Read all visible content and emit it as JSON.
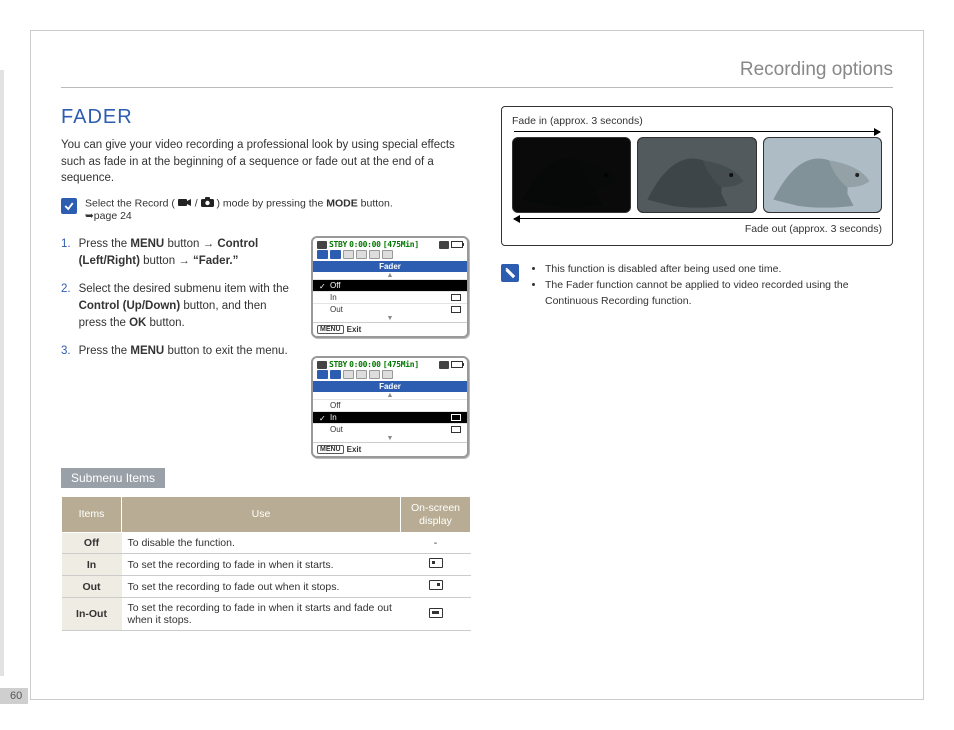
{
  "header": {
    "title": "Recording options"
  },
  "section": {
    "title": "FADER",
    "intro": "You can give your video recording a professional look by using special effects such as fade in at the beginning of a sequence or fade out at the end of a sequence."
  },
  "mode_note": {
    "prefix": "Select the Record (",
    "mid": " / ",
    "suffix": ") mode by pressing the ",
    "mode_word": "MODE",
    "suffix2": " button.",
    "pageref": "➥page 24"
  },
  "steps": [
    {
      "num": "1.",
      "html": "Press the <b>MENU</b> button → <b>Control (Left/Right)</b> button → <b>“Fader.”</b>"
    },
    {
      "num": "2.",
      "html": "Select the desired submenu item with the <b>Control (Up/Down)</b> button, and then press the <b>OK</b> button."
    },
    {
      "num": "3.",
      "html": "Press the <b>MENU</b> button to exit the menu."
    }
  ],
  "lcd": {
    "status": "STBY",
    "time": "0:00:00",
    "remain": "[475Min]",
    "menu_title": "Fader",
    "rows1": [
      {
        "label": "Off",
        "selected": true,
        "checked": true,
        "ind": false
      },
      {
        "label": "In",
        "selected": false,
        "checked": false,
        "ind": true
      },
      {
        "label": "Out",
        "selected": false,
        "checked": false,
        "ind": true
      }
    ],
    "rows2": [
      {
        "label": "Off",
        "selected": false,
        "checked": false,
        "ind": false
      },
      {
        "label": "In",
        "selected": true,
        "checked": true,
        "ind": true
      },
      {
        "label": "Out",
        "selected": false,
        "checked": false,
        "ind": true
      }
    ],
    "menu_btn": "MENU",
    "exit": "Exit"
  },
  "submenu": {
    "heading": "Submenu Items",
    "cols": {
      "c1": "Items",
      "c2": "Use",
      "c3": "On-screen display"
    },
    "rows": [
      {
        "item": "Off",
        "use": "To disable the function.",
        "disp": "-"
      },
      {
        "item": "In",
        "use": "To set the recording to fade in when it starts.",
        "disp": "in"
      },
      {
        "item": "Out",
        "use": "To set the recording to fade out when it stops.",
        "disp": "out"
      },
      {
        "item": "In-Out",
        "use": "To set the recording to fade in when it starts and fade out when it stops.",
        "disp": "inout"
      }
    ]
  },
  "fadebox": {
    "top": "Fade in (approx. 3 seconds)",
    "bottom": "Fade out (approx. 3 seconds)"
  },
  "notes2": {
    "items": [
      "This function is disabled after being used one time.",
      "The Fader function cannot be applied to video recorded using the Continuous Recording function."
    ]
  },
  "page_number": "60"
}
